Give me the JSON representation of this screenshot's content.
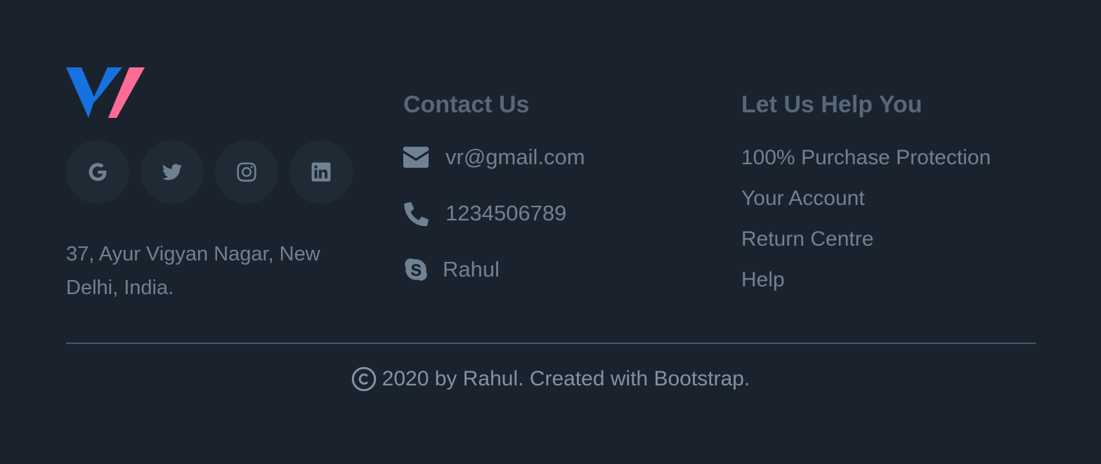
{
  "brand": {
    "logo_colors": {
      "left": "#1672de",
      "right": "#ff6b97"
    }
  },
  "socials": [
    {
      "icon": "google-icon"
    },
    {
      "icon": "twitter-icon"
    },
    {
      "icon": "instagram-icon"
    },
    {
      "icon": "linkedin-icon"
    }
  ],
  "address": "37, Ayur Vigyan Nagar, New Delhi, India.",
  "contact": {
    "heading": "Contact Us",
    "email": "vr@gmail.com",
    "phone": "1234506789",
    "skype": "Rahul"
  },
  "help": {
    "heading": "Let Us Help You",
    "links": [
      "100% Purchase Protection",
      "Your Account",
      "Return Centre",
      "Help"
    ]
  },
  "footer": {
    "copyright": "2020 by Rahul. Created with Bootstrap."
  },
  "colors": {
    "background": "#1a222d",
    "text": "#6f8294",
    "heading": "#56687a",
    "social_bg": "#202a35"
  }
}
